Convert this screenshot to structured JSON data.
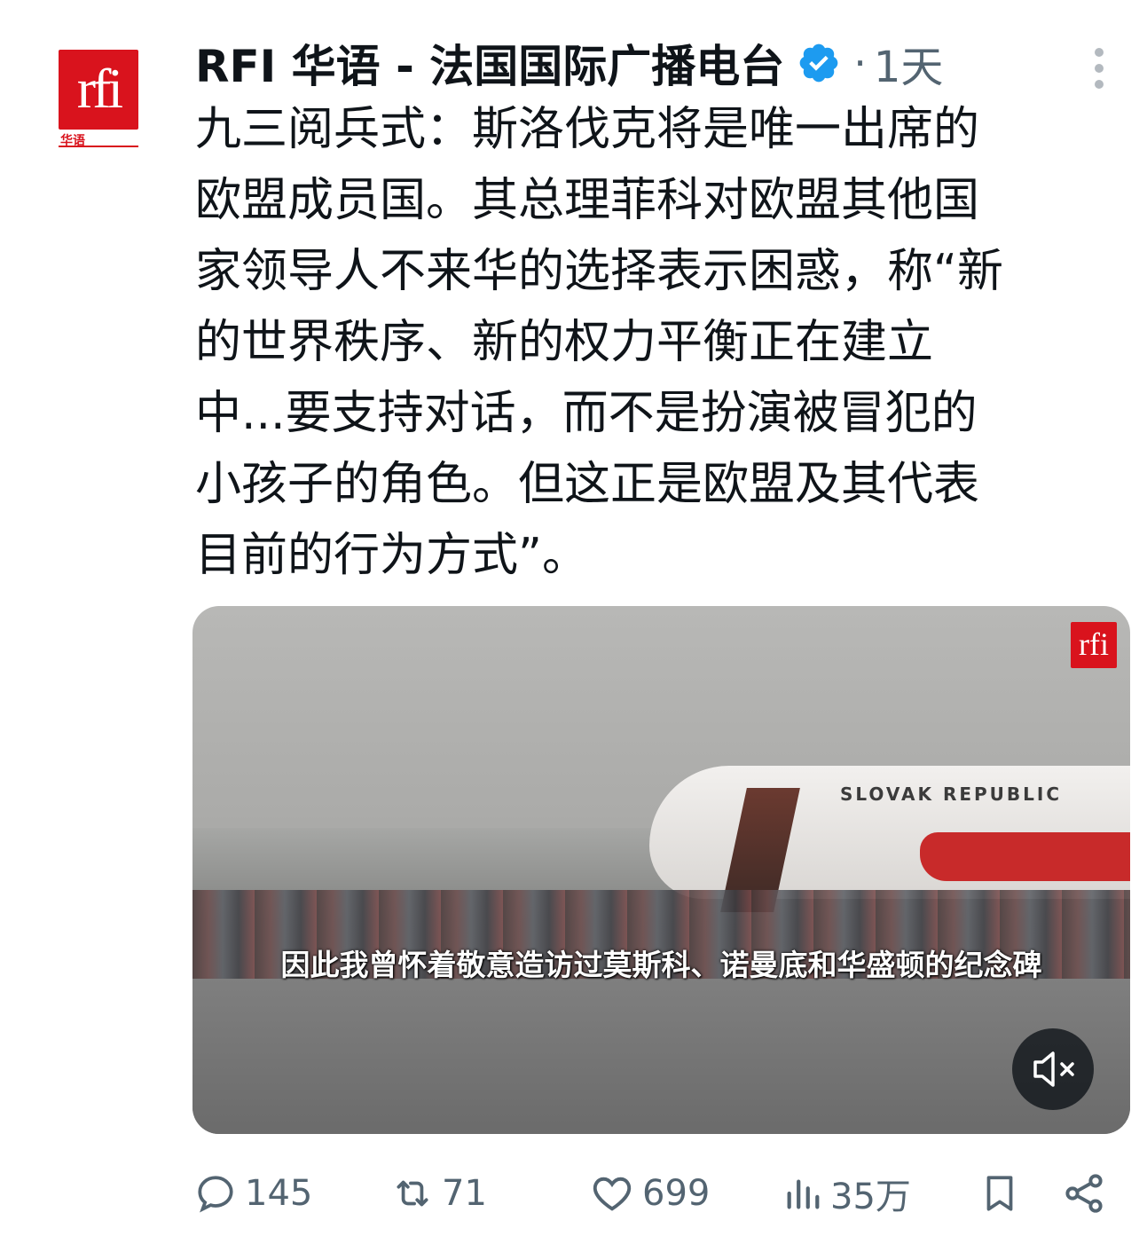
{
  "post": {
    "author": "RFI 华语 - 法国国际广播电台",
    "avatar_text": "rfi",
    "avatar_subtext": "华语",
    "time_sep": "·",
    "time": "1天",
    "body_lines": [
      "九三阅兵式：斯洛伐克将是唯一出席的",
      "欧盟成员国。其总理菲科对欧盟其他国",
      "家领导人不来华的选择表示困惑，称“新",
      "的世界秩序、新的权力平衡正在建立",
      "中...要支持对话，而不是扮演被冒犯的",
      "小孩子的角色。但这正是欧盟及其代表",
      "目前的行为方式”。"
    ]
  },
  "media": {
    "badge": "rfi",
    "plane_label": "SLOVAK REPUBLIC",
    "subtitle": "因此我曾怀着敬意造访过莫斯科、诺曼底和华盛顿的纪念碑",
    "mute_icon": "volume-muted-icon"
  },
  "actions": {
    "replies": "145",
    "reposts": "71",
    "likes": "699",
    "views": "35万"
  },
  "colors": {
    "brand_red": "#d9131d",
    "verified_blue": "#1d9bf0",
    "muted_text": "#536471"
  }
}
